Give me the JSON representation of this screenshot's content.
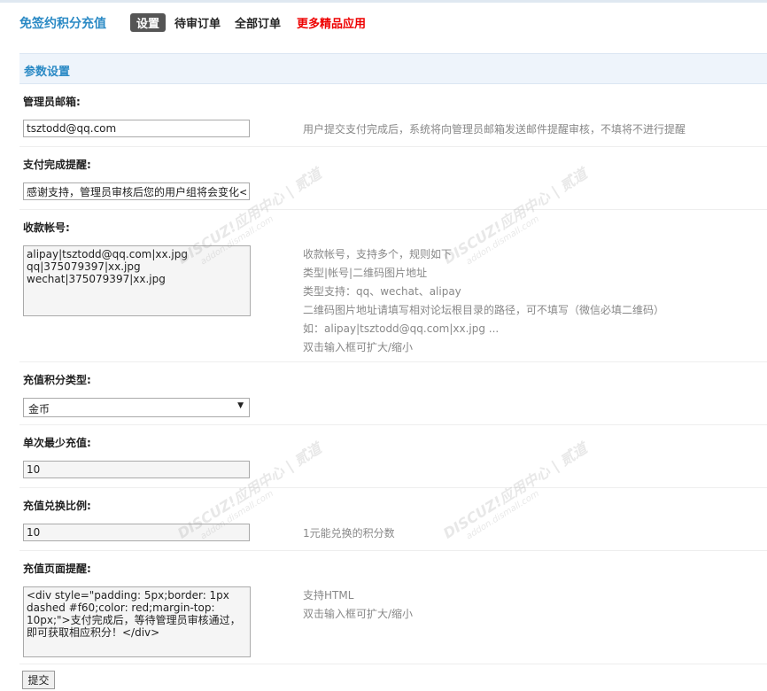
{
  "app_title": "免签约积分充值",
  "nav": [
    {
      "label": "设置",
      "active": true
    },
    {
      "label": "待审订单"
    },
    {
      "label": "全部订单"
    },
    {
      "label": "更多精品应用",
      "highlight_color": "#e00000"
    }
  ],
  "section_title": "参数设置",
  "fields": {
    "admin_email": {
      "label": "管理员邮箱:",
      "value": "tsztodd@qq.com",
      "tip": "用户提交支付完成后，系统将向管理员邮箱发送邮件提醒审核，不填将不进行提醒"
    },
    "pay_notice": {
      "label": "支付完成提醒:",
      "value": "感谢支持，管理员审核后您的用户组将会变化<"
    },
    "accounts": {
      "label": "收款帐号:",
      "value": "alipay|tsztodd@qq.com|xx.jpg\nqq|375079397|xx.jpg\nwechat|375079397|xx.jpg",
      "tips": [
        "收款帐号，支持多个，规则如下",
        "类型|帐号|二维码图片地址",
        "类型支持：qq、wechat、alipay",
        "二维码图片地址请填写相对论坛根目录的路径，可不填写（微信必填二维码）",
        "如：alipay|tsztodd@qq.com|xx.jpg ...",
        "双击输入框可扩大/缩小"
      ]
    },
    "credit_type": {
      "label": "充值积分类型:",
      "selected": "金币"
    },
    "min_amount": {
      "label": "单次最少充值:",
      "value": "10"
    },
    "ratio": {
      "label": "充值兑换比例:",
      "value": "10",
      "tip": "1元能兑换的积分数"
    },
    "page_notice": {
      "label": "充值页面提醒:",
      "value": "<div style=\"padding: 5px;border: 1px dashed #f60;color: red;margin-top: 10px;\">支付完成后，等待管理员审核通过，即可获取相应积分！</div>",
      "tips": [
        "支持HTML",
        "双击输入框可扩大/缩小"
      ]
    }
  },
  "submit_label": "提交",
  "watermark": {
    "brand": "DISCUZ!应用中心 | 贰道",
    "domain": "addon.dismall.com"
  },
  "colors": {
    "accent": "#2b8ac5",
    "highlight": "#e00000",
    "section_bg": "#eef4fb"
  }
}
